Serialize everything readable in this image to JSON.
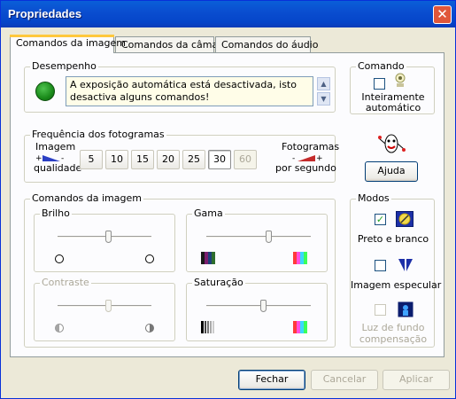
{
  "window": {
    "title": "Propriedades"
  },
  "tabs": [
    {
      "label": "Comandos da imagem",
      "active": true
    },
    {
      "label": "Comandos da câmara",
      "active": false
    },
    {
      "label": "Comandos do áudio",
      "active": false
    }
  ],
  "desempenho": {
    "legend": "Desempenho",
    "message": "A exposição automática está desactivada, isto desactiva alguns comandos!",
    "status_color": "#1a8a1a"
  },
  "comando": {
    "legend": "Comando",
    "checkbox_label": "Inteiramente automático",
    "checked": false
  },
  "frequencia": {
    "legend": "Frequência dos fotogramas",
    "left_label_top": "Imagem",
    "left_label_bottom": "qualidade",
    "right_label_top": "Fotogramas",
    "right_label_bottom": "por segundo",
    "options": [
      "5",
      "10",
      "15",
      "20",
      "25",
      "30",
      "60"
    ],
    "selected": "30",
    "disabled": [
      "60"
    ]
  },
  "help_button": {
    "label": "Ajuda"
  },
  "image_controls": {
    "legend": "Comandos da imagem",
    "brilho": {
      "label": "Brilho",
      "value": 0.55,
      "enabled": true
    },
    "gama": {
      "label": "Gama",
      "value": 0.6,
      "enabled": true
    },
    "contraste": {
      "label": "Contraste",
      "value": 0.55,
      "enabled": false
    },
    "saturacao": {
      "label": "Saturação",
      "value": 0.55,
      "enabled": true
    }
  },
  "modos": {
    "legend": "Modos",
    "items": [
      {
        "label": "Preto e branco",
        "checked": true,
        "enabled": true
      },
      {
        "label": "Imagem especular",
        "checked": false,
        "enabled": true
      },
      {
        "label": "Luz de fundo compensação",
        "checked": false,
        "enabled": false
      }
    ]
  },
  "footer": {
    "close_label": "Fechar",
    "cancel_label": "Cancelar",
    "apply_label": "Aplicar"
  },
  "colors": {
    "title_bar": "#0a4ed0",
    "tab_highlight": "#ffc83c",
    "close_button": "#e0573a"
  }
}
